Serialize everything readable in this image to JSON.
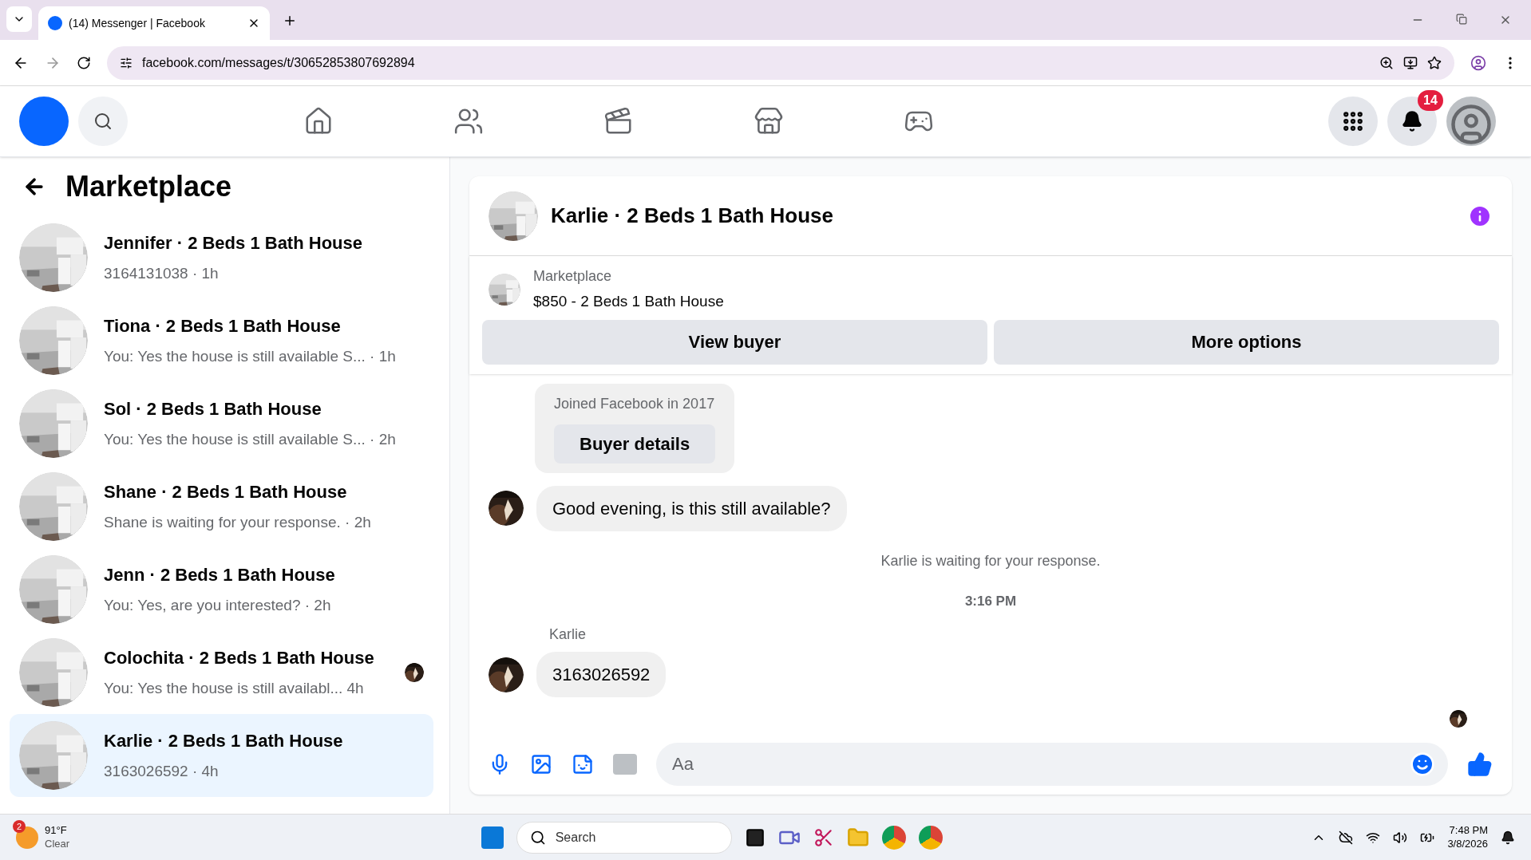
{
  "browser": {
    "tab_title": "(14) Messenger | Facebook",
    "url": "facebook.com/messages/t/30652853807692894"
  },
  "header": {
    "notifications": "14",
    "nav": [
      {
        "kind": "home",
        "selected": false
      },
      {
        "kind": "friends",
        "selected": false
      },
      {
        "kind": "video",
        "selected": false
      },
      {
        "kind": "marketplace",
        "selected": false
      },
      {
        "kind": "gaming",
        "selected": false
      }
    ]
  },
  "sidebar": {
    "title": "Marketplace",
    "conversations": [
      {
        "title": "Jennifer · 2 Beds 1 Bath House",
        "subtitle": "3164131038 · 1h",
        "selected": false,
        "seen": false
      },
      {
        "title": "Tiona · 2 Beds 1 Bath House",
        "subtitle": "You: Yes the house is still available S... · 1h",
        "selected": false,
        "seen": false
      },
      {
        "title": "Sol · 2 Beds 1 Bath House",
        "subtitle": "You: Yes the house is still available S... · 2h",
        "selected": false,
        "seen": false
      },
      {
        "title": "Shane · 2 Beds 1 Bath House",
        "subtitle": "Shane is waiting for your response. · 2h",
        "selected": false,
        "seen": false
      },
      {
        "title": "Jenn · 2 Beds 1 Bath House",
        "subtitle": "You: Yes, are you interested? · 2h",
        "selected": false,
        "seen": false
      },
      {
        "title": "Colochita · 2 Beds 1 Bath House",
        "subtitle": "You: Yes the house is still availabl...  4h",
        "selected": false,
        "seen": true
      },
      {
        "title": "Karlie · 2 Beds 1 Bath House",
        "subtitle": "3163026592 · 4h",
        "selected": true,
        "seen": false
      }
    ]
  },
  "chat": {
    "title": "Karlie · 2 Beds 1 Bath House",
    "listing": {
      "label": "Marketplace",
      "title": "$850 - 2 Beds 1 Bath House"
    },
    "buttons": [
      "View buyer",
      "More options"
    ],
    "buyer_card": {
      "text": "Joined Facebook in 2017",
      "button": "Buyer details"
    },
    "messages": [
      {
        "kind": "message",
        "text": "Good evening, is this still available?"
      },
      {
        "kind": "status",
        "text": "Karlie is waiting for your response."
      },
      {
        "kind": "time",
        "text": "3:16 PM"
      },
      {
        "kind": "message",
        "sender": "Karlie",
        "text": "3163026592"
      }
    ],
    "composer": {
      "placeholder": "Aa"
    }
  },
  "taskbar": {
    "weather_badge": "2",
    "temperature": "91°F",
    "condition": "Clear",
    "search": "Search",
    "time": "7:48 PM",
    "date": "3/8/2026"
  }
}
